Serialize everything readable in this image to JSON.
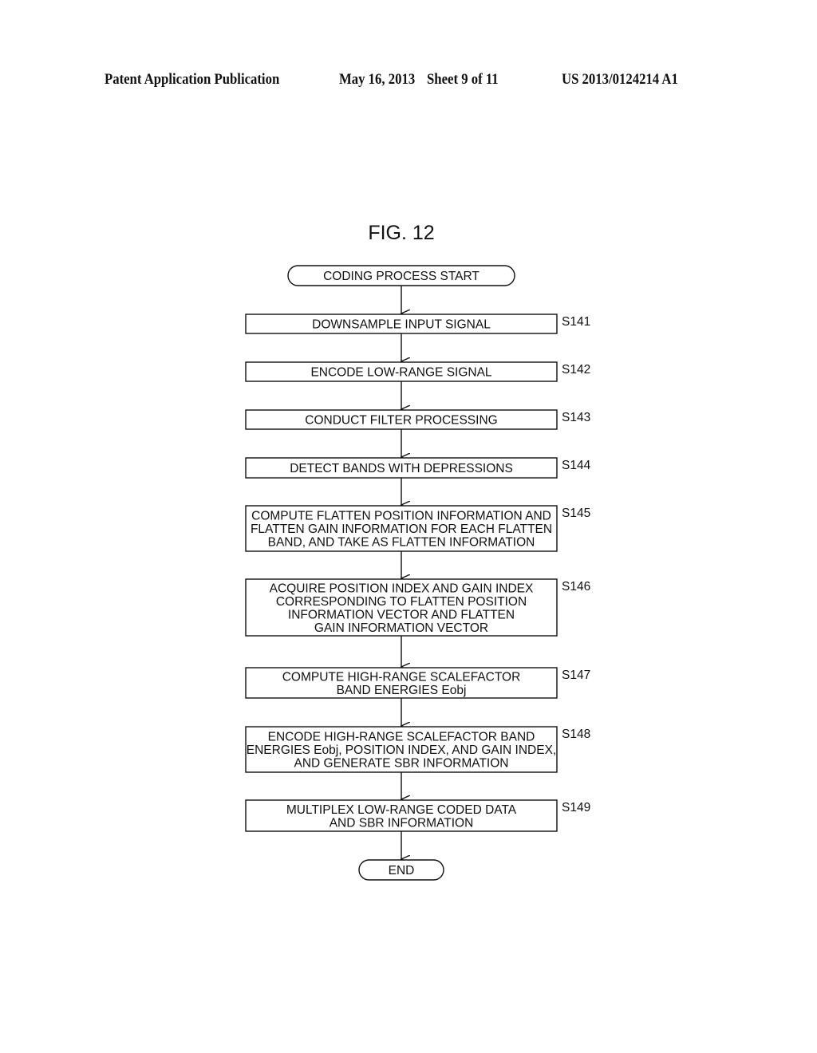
{
  "header": {
    "publication_type": "Patent Application Publication",
    "date": "May 16, 2013",
    "sheet": "Sheet 9 of 11",
    "publication_number": "US 2013/0124214 A1"
  },
  "figure": {
    "title": "FIG. 12",
    "start": "CODING PROCESS START",
    "end": "END",
    "steps": [
      {
        "id": "S141",
        "lines": [
          "DOWNSAMPLE INPUT SIGNAL"
        ]
      },
      {
        "id": "S142",
        "lines": [
          "ENCODE LOW-RANGE SIGNAL"
        ]
      },
      {
        "id": "S143",
        "lines": [
          "CONDUCT FILTER PROCESSING"
        ]
      },
      {
        "id": "S144",
        "lines": [
          "DETECT BANDS WITH DEPRESSIONS"
        ]
      },
      {
        "id": "S145",
        "lines": [
          "COMPUTE FLATTEN POSITION INFORMATION AND",
          "FLATTEN GAIN INFORMATION FOR EACH FLATTEN",
          "BAND, AND TAKE AS FLATTEN INFORMATION"
        ]
      },
      {
        "id": "S146",
        "lines": [
          "ACQUIRE POSITION INDEX AND GAIN INDEX",
          "CORRESPONDING TO FLATTEN POSITION",
          "INFORMATION VECTOR AND FLATTEN",
          "GAIN INFORMATION VECTOR"
        ]
      },
      {
        "id": "S147",
        "lines": [
          "COMPUTE HIGH-RANGE SCALEFACTOR",
          "BAND ENERGIES Eobj"
        ]
      },
      {
        "id": "S148",
        "lines": [
          "ENCODE HIGH-RANGE SCALEFACTOR BAND",
          "ENERGIES Eobj, POSITION INDEX, AND GAIN INDEX,",
          "AND GENERATE SBR INFORMATION"
        ]
      },
      {
        "id": "S149",
        "lines": [
          "MULTIPLEX LOW-RANGE CODED DATA",
          "AND SBR INFORMATION"
        ]
      }
    ]
  }
}
